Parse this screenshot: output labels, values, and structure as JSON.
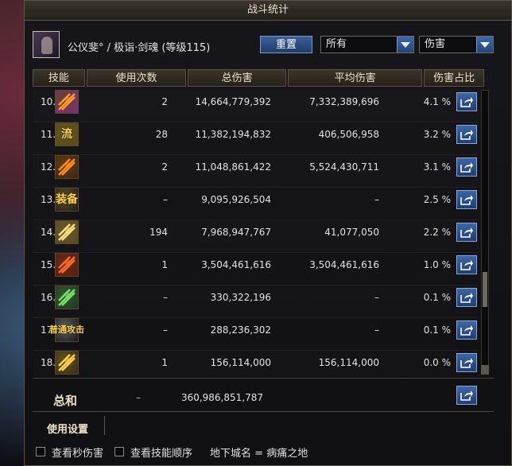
{
  "window": {
    "title": "战斗统计"
  },
  "character": {
    "name": "公仪斐° / 极诣·剑魂 (等级115)"
  },
  "toolbar": {
    "reset_label": "重置",
    "filter_value": "所有",
    "metric_value": "伤害"
  },
  "columns": [
    "技能",
    "使用次数",
    "总伤害",
    "平均伤害",
    "伤害占比"
  ],
  "rows": [
    {
      "rank": "10.",
      "uses": "2",
      "total": "14,664,779,392",
      "avg": "7,332,389,696",
      "pct": "4.1 %",
      "icon": "flame-slash-icon",
      "icon_colors": [
        "#7a2d8a",
        "#ff9a2a"
      ]
    },
    {
      "rank": "11.",
      "uses": "28",
      "total": "11,382,194,832",
      "avg": "406,506,958",
      "pct": "3.2 %",
      "icon": "flow-sword-icon",
      "icon_text": "流",
      "icon_colors": [
        "#5a4a15",
        "#ffd34a"
      ]
    },
    {
      "rank": "12.",
      "uses": "2",
      "total": "11,048,861,422",
      "avg": "5,524,430,711",
      "pct": "3.1 %",
      "icon": "burst-icon",
      "icon_colors": [
        "#3a2510",
        "#ff8a1a"
      ]
    },
    {
      "rank": "13.",
      "uses": "–",
      "total": "9,095,926,504",
      "avg": "–",
      "pct": "2.5 %",
      "icon": "equipment-icon",
      "icon_text": "装备",
      "icon_colors": [
        "#1a1a1a",
        "#ffd34a"
      ]
    },
    {
      "rank": "14.",
      "uses": "194",
      "total": "7,968,947,767",
      "avg": "41,077,050",
      "pct": "2.2 %",
      "icon": "sword-strike-icon",
      "icon_colors": [
        "#5a4a1a",
        "#ffe07a"
      ]
    },
    {
      "rank": "15.",
      "uses": "1",
      "total": "3,504,461,616",
      "avg": "3,504,461,616",
      "pct": "1.0 %",
      "icon": "cross-blade-icon",
      "icon_colors": [
        "#5a1a10",
        "#ff6a2a"
      ]
    },
    {
      "rank": "16.",
      "uses": "–",
      "total": "330,322,196",
      "avg": "–",
      "pct": "0.1 %",
      "icon": "green-slash-icon",
      "icon_colors": [
        "#1a3a20",
        "#7ae06a"
      ]
    },
    {
      "rank": "17.",
      "uses": "–",
      "total": "288,236,302",
      "avg": "–",
      "pct": "0.1 %",
      "icon": "normal-attack-icon",
      "icon_text": "普通攻击",
      "icon_colors": [
        "#1a1a1a",
        "#ffffff"
      ]
    },
    {
      "rank": "18.",
      "uses": "1",
      "total": "156,114,000",
      "avg": "156,114,000",
      "pct": "0.0 %",
      "icon": "spiral-icon",
      "icon_colors": [
        "#3a2a10",
        "#ffd34a"
      ]
    }
  ],
  "summary": {
    "label": "总和",
    "uses": "–",
    "total": "360,986,851,787"
  },
  "settings": {
    "label": "使用设置"
  },
  "options": {
    "view_dps_label": "查看秒伤害",
    "view_skill_order_label": "查看技能顺序",
    "dungeon": "地下城名 = 病痛之地"
  },
  "colors": {
    "accent": "#2f5591",
    "header_bg": "#3b3428",
    "text_gold": "#ece2c8"
  }
}
